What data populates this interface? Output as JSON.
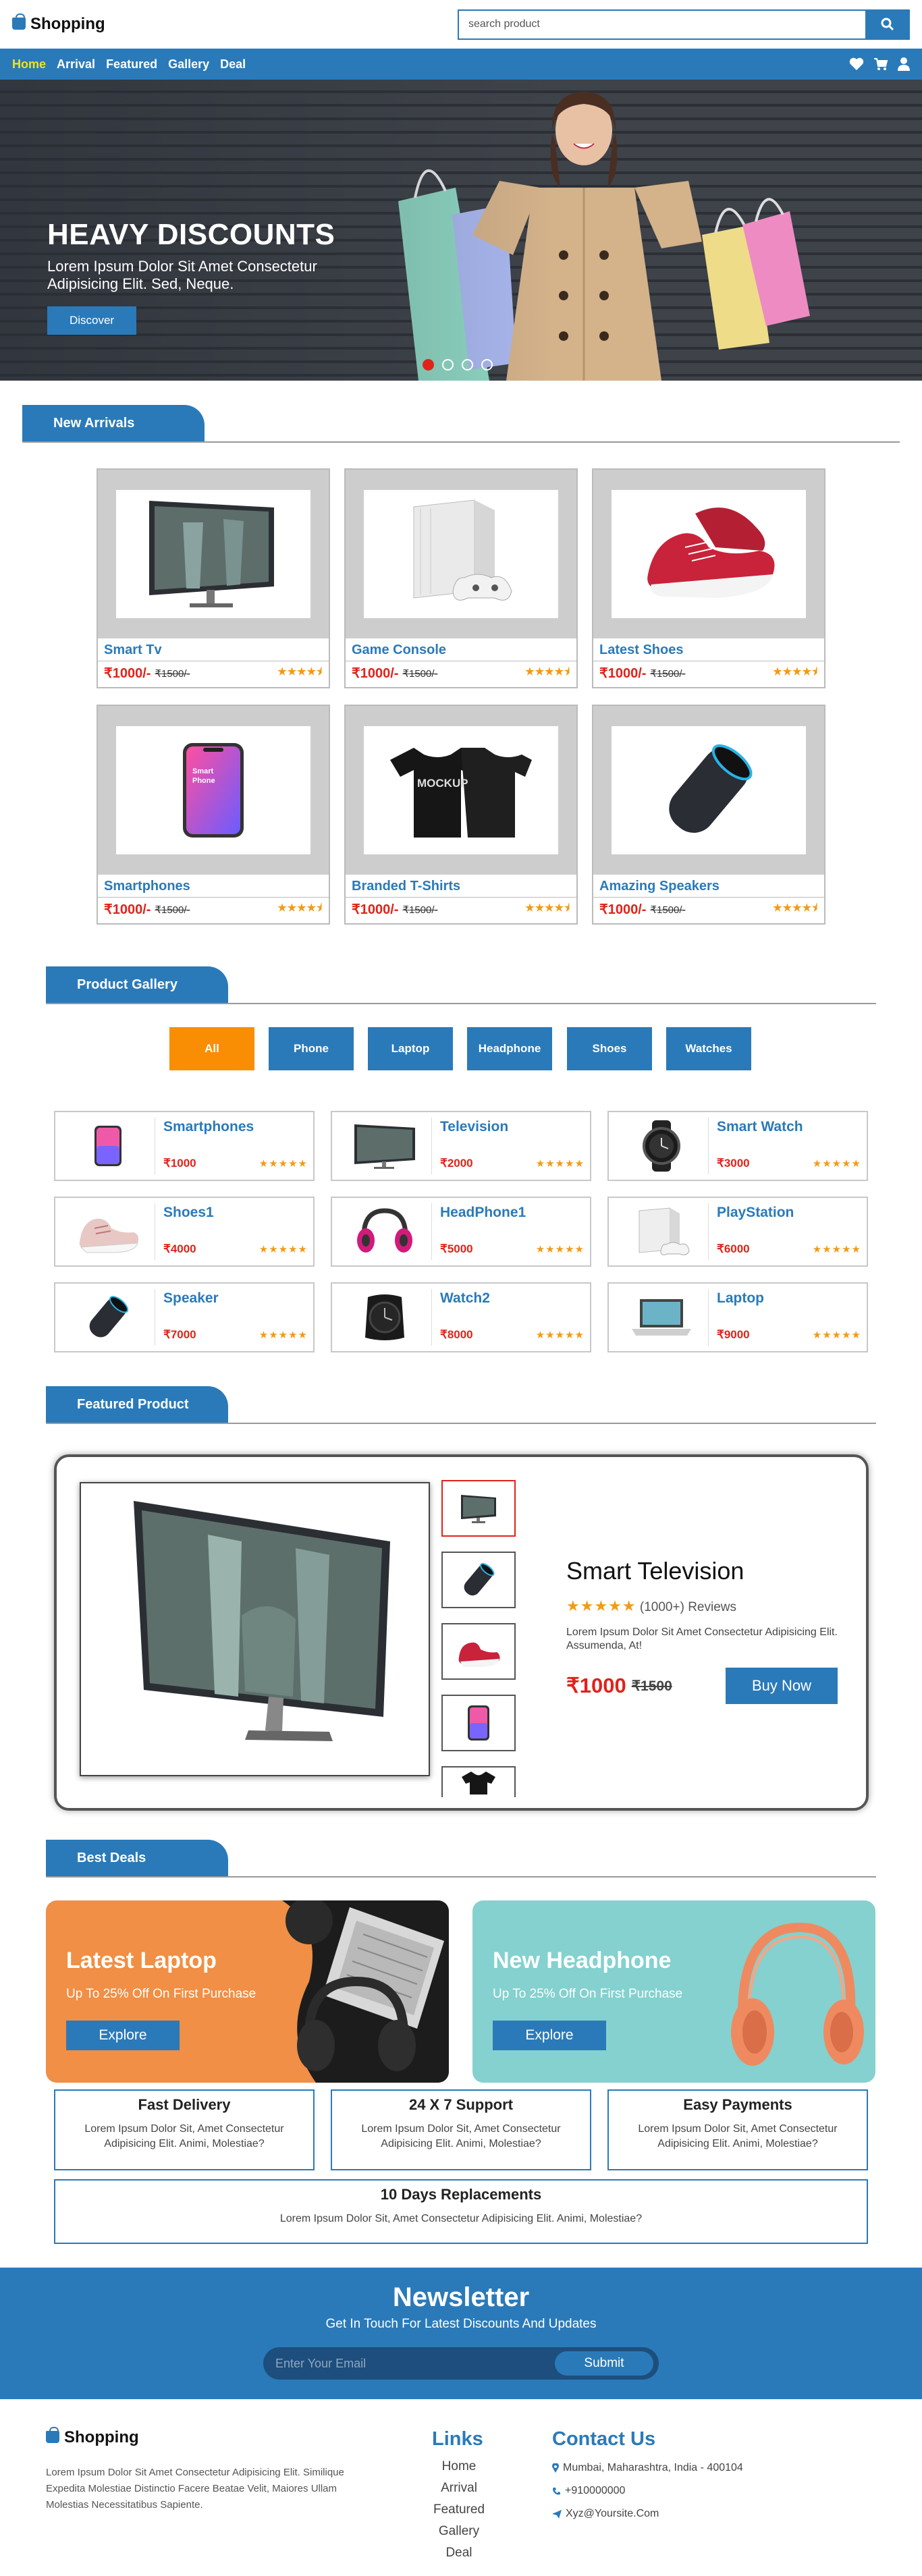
{
  "header": {
    "brand": "Shopping",
    "search_placeholder": "search product"
  },
  "nav": {
    "items": [
      "Home",
      "Arrival",
      "Featured",
      "Gallery",
      "Deal"
    ],
    "active": "Home"
  },
  "hero": {
    "title": "HEAVY DISCOUNTS",
    "text": "Lorem Ipsum Dolor Sit Amet Consectetur Adipisicing Elit. Sed, Neque.",
    "button": "Discover",
    "slides": 4,
    "active_slide": 1
  },
  "new_arrivals": {
    "heading": "New Arrivals",
    "items": [
      {
        "name": "Smart Tv",
        "price": "₹1000/-",
        "old_price": "₹1500/-",
        "rating": 4.5,
        "icon": "monitor-icon"
      },
      {
        "name": "Game Console",
        "price": "₹1000/-",
        "old_price": "₹1500/-",
        "rating": 4.5,
        "icon": "game-console-icon"
      },
      {
        "name": "Latest Shoes",
        "price": "₹1000/-",
        "old_price": "₹1500/-",
        "rating": 4.5,
        "icon": "shoe-icon"
      },
      {
        "name": "Smartphones",
        "price": "₹1000/-",
        "old_price": "₹1500/-",
        "rating": 4.5,
        "icon": "phone-icon"
      },
      {
        "name": "Branded T-Shirts",
        "price": "₹1000/-",
        "old_price": "₹1500/-",
        "rating": 4.5,
        "icon": "tshirt-icon"
      },
      {
        "name": "Amazing Speakers",
        "price": "₹1000/-",
        "old_price": "₹1500/-",
        "rating": 4.5,
        "icon": "speaker-icon"
      }
    ]
  },
  "gallery": {
    "heading": "Product Gallery",
    "filters": [
      "All",
      "Phone",
      "Laptop",
      "Headphone",
      "Shoes",
      "Watches"
    ],
    "active_filter": "All",
    "items": [
      {
        "name": "Smartphones",
        "price": "₹1000",
        "icon": "phone-icon"
      },
      {
        "name": "Television",
        "price": "₹2000",
        "icon": "monitor-icon"
      },
      {
        "name": "Smart Watch",
        "price": "₹3000",
        "icon": "watch-icon"
      },
      {
        "name": "Shoes1",
        "price": "₹4000",
        "icon": "shoe-icon"
      },
      {
        "name": "HeadPhone1",
        "price": "₹5000",
        "icon": "headphone-icon"
      },
      {
        "name": "PlayStation",
        "price": "₹6000",
        "icon": "game-console-icon"
      },
      {
        "name": "Speaker",
        "price": "₹7000",
        "icon": "speaker-icon"
      },
      {
        "name": "Watch2",
        "price": "₹8000",
        "icon": "watch-icon"
      },
      {
        "name": "Laptop",
        "price": "₹9000",
        "icon": "laptop-icon"
      }
    ]
  },
  "featured": {
    "heading": "Featured Product",
    "name": "Smart Television",
    "reviews": "(1000+) Reviews",
    "rating": 5,
    "description": "Lorem Ipsum Dolor Sit Amet Consectetur Adipisicing Elit. Assumenda, At!",
    "price": "₹1000",
    "old_price": "₹1500",
    "button": "Buy Now"
  },
  "deals": {
    "heading": "Best Deals",
    "items": [
      {
        "title": "Latest Laptop",
        "subtitle": "Up To 25% Off On First Purchase",
        "button": "Explore",
        "color": "#f08f45"
      },
      {
        "title": "New Headphone",
        "subtitle": "Up To 25% Off On First Purchase",
        "button": "Explore",
        "color": "#84d1cf"
      }
    ]
  },
  "features": [
    {
      "title": "Fast Delivery",
      "text": "Lorem Ipsum Dolor Sit, Amet Consectetur Adipisicing Elit. Animi, Molestiae?"
    },
    {
      "title": "24 X 7 Support",
      "text": "Lorem Ipsum Dolor Sit, Amet Consectetur Adipisicing Elit. Animi, Molestiae?"
    },
    {
      "title": "Easy Payments",
      "text": "Lorem Ipsum Dolor Sit, Amet Consectetur Adipisicing Elit. Animi, Molestiae?"
    },
    {
      "title": "10 Days Replacements",
      "text": "Lorem Ipsum Dolor Sit, Amet Consectetur Adipisicing Elit. Animi, Molestiae?"
    }
  ],
  "newsletter": {
    "title": "Newsletter",
    "subtitle": "Get In Touch For Latest Discounts And Updates",
    "placeholder": "Enter Your Email",
    "button": "Submit"
  },
  "footer": {
    "brand": "Shopping",
    "about": "Lorem Ipsum Dolor Sit Amet Consectetur Adipisicing Elit. Similique Expedita Molestiae Distinctio Facere Beatae Velit, Maiores Ullam Molestias Necessitatibus Sapiente.",
    "links_title": "Links",
    "links": [
      "Home",
      "Arrival",
      "Featured",
      "Gallery",
      "Deal"
    ],
    "contact_title": "Contact Us",
    "address": "Mumbai, Maharashtra, India - 400104",
    "phone": "+910000000",
    "email": "Xyz@Yoursite.Com"
  },
  "colors": {
    "brand": "#2a7ab9",
    "price": "#e0231a",
    "star": "#f29a16",
    "filter_active": "#f98e05",
    "nav_active": "#f4e21c"
  }
}
